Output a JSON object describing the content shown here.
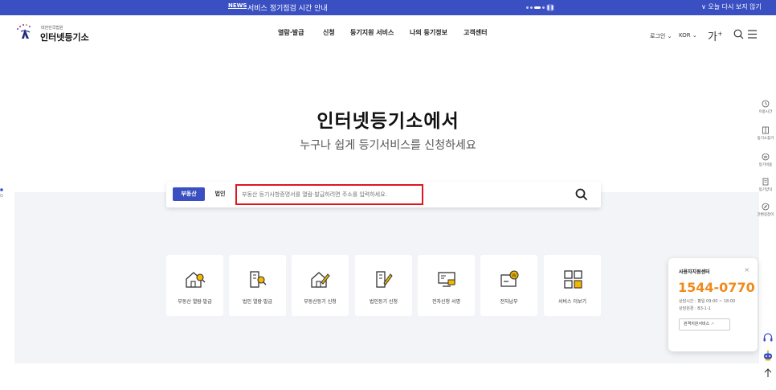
{
  "notice": {
    "tag": "NEWS",
    "text": "서비스 정기점검 시간 안내",
    "pause_icon": "pause-icon",
    "close_text": "∨ 오늘 다시 보지 않기"
  },
  "header": {
    "logo_small": "대한민국법원",
    "logo_text": "인터넷등기소",
    "nav": [
      "열람·발급",
      "신청",
      "등기지원 서비스",
      "나의 등기정보",
      "고객센터"
    ],
    "login": "로그인",
    "lang": "KOR",
    "font_size": "가",
    "font_plus": "+"
  },
  "hero": {
    "title": "인터넷등기소에서",
    "subtitle": "누구나 쉽게 등기서비스를 신청하세요"
  },
  "search": {
    "tabs": [
      "부동산",
      "법인"
    ],
    "placeholder": "부동산 등기사항증명서를 열람·발급하려면 주소를 입력하세요."
  },
  "services": [
    {
      "label": "부동산 열람·발급",
      "icon": "house-search-icon"
    },
    {
      "label": "법인 열람·발급",
      "icon": "building-search-icon"
    },
    {
      "label": "부동산등기 신청",
      "icon": "house-pen-icon"
    },
    {
      "label": "법인등기 신청",
      "icon": "building-pen-icon"
    },
    {
      "label": "전자신청 서명",
      "icon": "monitor-sign-icon"
    },
    {
      "label": "전자납부",
      "icon": "wallet-coin-icon"
    },
    {
      "label": "서비스 더보기",
      "icon": "grid-more-icon"
    }
  ],
  "quick_menu": [
    {
      "label": "이용시간",
      "icon": "clock-icon"
    },
    {
      "label": "등기소찾기",
      "icon": "map-book-icon"
    },
    {
      "label": "등기비용",
      "icon": "coin-icon"
    },
    {
      "label": "등기양식",
      "icon": "document-icon"
    },
    {
      "label": "간편길잡이",
      "icon": "compass-icon"
    }
  ],
  "helpdesk": {
    "title": "사용자지원센터",
    "phone": "1544-0770",
    "hours": "상담시간 : 평일 09:00 ~ 18:00",
    "location": "상담원경 : B3-1-1",
    "remote": "원격지원서비스"
  },
  "colors": {
    "primary": "#3a4fc2",
    "accent_orange": "#f08a1c",
    "highlight_red": "#e0141e",
    "section_grey": "#f3f4f7"
  }
}
